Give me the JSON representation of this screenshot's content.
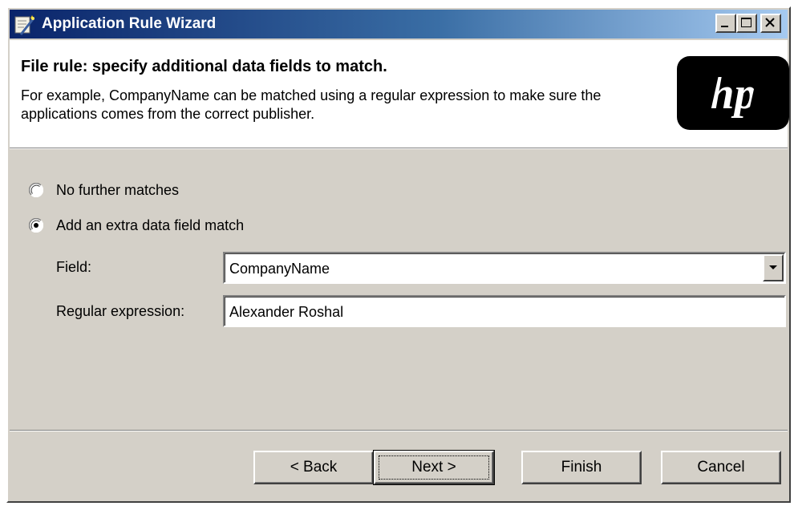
{
  "window": {
    "title": "Application Rule Wizard",
    "app_icon": "wizard-wand-icon",
    "controls": {
      "minimize": "minimize-icon",
      "maximize": "maximize-icon",
      "close": "close-icon"
    }
  },
  "header": {
    "title": "File rule: specify additional data fields to match.",
    "description": "For example, CompanyName can be matched using a regular expression to make sure the applications comes from the correct publisher.",
    "logo_text": "hp"
  },
  "options": {
    "no_further": {
      "label": "No further matches",
      "checked": false
    },
    "add_extra": {
      "label": "Add an extra data field match",
      "checked": true
    }
  },
  "form": {
    "field_label": "Field:",
    "field_value": "CompanyName",
    "regex_label": "Regular expression:",
    "regex_value": "Alexander Roshal"
  },
  "buttons": {
    "back": "< Back",
    "next": "Next >",
    "finish": "Finish",
    "cancel": "Cancel"
  },
  "colors": {
    "dialog_bg": "#d4d0c8",
    "title_gradient_start": "#0a246a",
    "title_gradient_end": "#a6caf0",
    "header_bg": "#ffffff"
  }
}
